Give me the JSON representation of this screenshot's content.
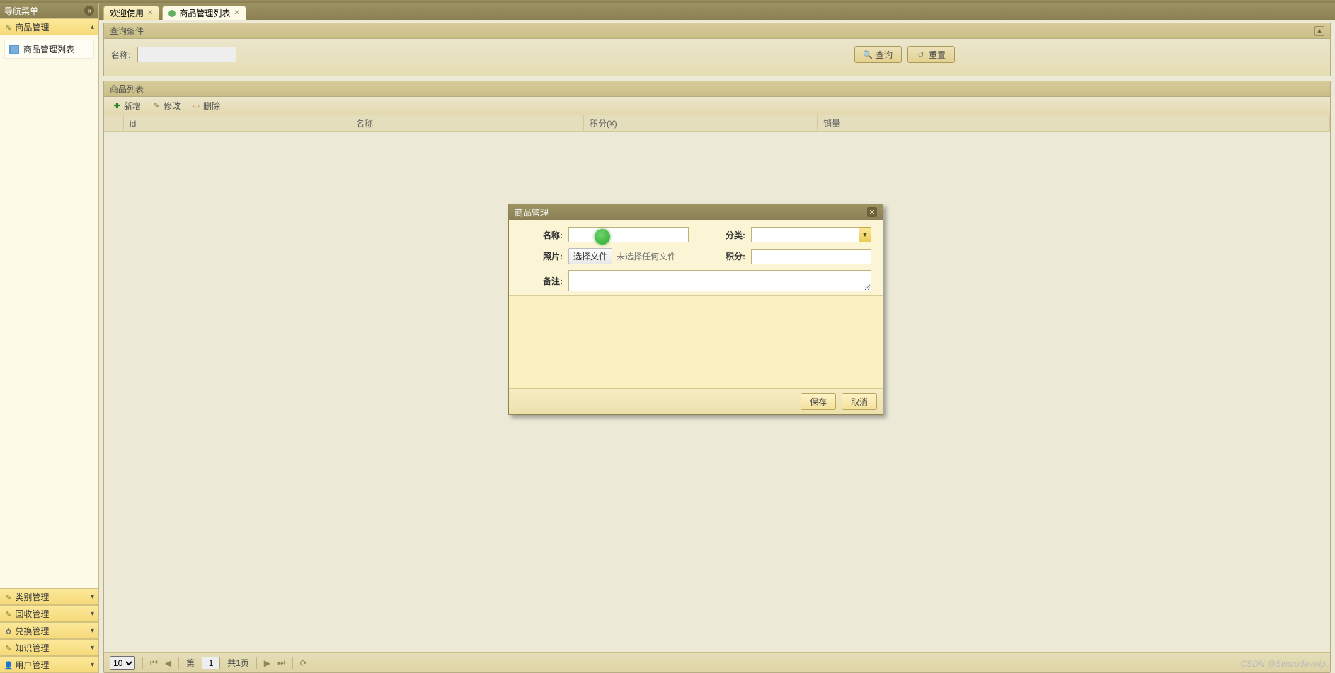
{
  "sidebar": {
    "title": "导航菜单",
    "sections": [
      {
        "label": "商品管理",
        "expanded": true,
        "items": [
          {
            "label": "商品管理列表"
          }
        ]
      },
      {
        "label": "类别管理"
      },
      {
        "label": "回收管理"
      },
      {
        "label": "兑换管理"
      },
      {
        "label": "知识管理"
      },
      {
        "label": "用户管理"
      }
    ]
  },
  "tabs": [
    {
      "label": "欢迎使用",
      "active": false,
      "closable": true
    },
    {
      "label": "商品管理列表",
      "active": true,
      "closable": true
    }
  ],
  "query": {
    "title": "查询条件",
    "name_label": "名称:",
    "name_value": "",
    "search_label": "查询",
    "reset_label": "重置"
  },
  "list": {
    "title": "商品列表",
    "toolbar": {
      "add": "新增",
      "edit": "修改",
      "delete": "删除"
    },
    "columns": {
      "id": "id",
      "name": "名称",
      "points": "积分(¥)",
      "sales": "销量"
    }
  },
  "pager": {
    "page_size": "10",
    "page_prefix": "第",
    "page_value": "1",
    "total_label": "共1页"
  },
  "modal": {
    "title": "商品管理",
    "name_label": "名称:",
    "name_value": "",
    "category_label": "分类:",
    "category_value": "",
    "photo_label": "照片:",
    "file_button": "选择文件",
    "file_hint": "未选择任何文件",
    "points_label": "积分:",
    "points_value": "",
    "remark_label": "备注:",
    "remark_value": "",
    "save_label": "保存",
    "cancel_label": "取消"
  },
  "watermark": "CSDN @Simzudevwip."
}
